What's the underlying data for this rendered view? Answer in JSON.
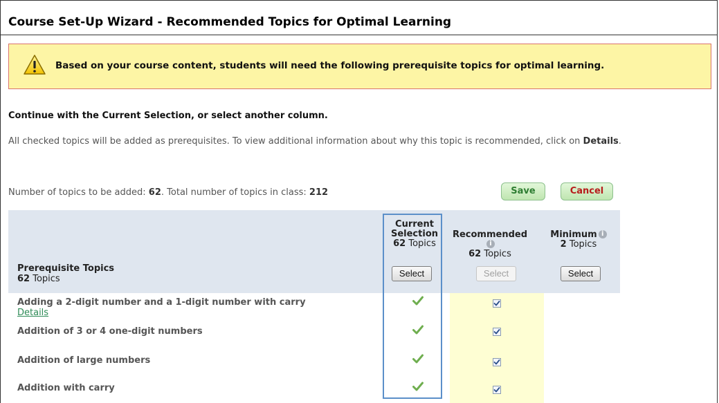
{
  "header": {
    "title": "Course Set-Up Wizard - Recommended Topics for Optimal Learning"
  },
  "banner": {
    "icon": "warning-icon",
    "text": "Based on your course content, students will need the following prerequisite topics for optimal learning."
  },
  "instructions": {
    "main": "Continue with the Current Selection, or select another column.",
    "desc_prefix": "All checked topics will be added as prerequisites. To view additional information about why this topic is recommended, click on ",
    "desc_bold": "Details",
    "desc_suffix": "."
  },
  "summary": {
    "added_label": "Number of topics to be added: ",
    "added_value": "62",
    "total_label": ".  Total number of topics in class: ",
    "total_value": "212"
  },
  "actions": {
    "save_label": "Save",
    "cancel_label": "Cancel"
  },
  "table": {
    "name_header": "Prerequisite Topics",
    "name_count": "62",
    "name_count_suffix": " Topics",
    "columns": [
      {
        "label_line1": "Current",
        "label_line2": "Selection",
        "count": "62",
        "count_suffix": " Topics",
        "button": "Select",
        "button_enabled": true
      },
      {
        "label": "Recommended",
        "count": "62",
        "count_suffix": " Topics",
        "button": "Select",
        "button_enabled": false
      },
      {
        "label": "Minimum",
        "count": "2",
        "count_suffix": " Topics",
        "button": "Select",
        "button_enabled": true
      }
    ],
    "rows": [
      {
        "name": "Adding a 2-digit number and a 1-digit number with carry",
        "details": "Details",
        "current": true,
        "recommended": true,
        "minimum": false
      },
      {
        "name": "Addition of 3 or 4 one-digit numbers",
        "current": true,
        "recommended": true,
        "minimum": false
      },
      {
        "name": "Addition of large numbers",
        "current": true,
        "recommended": true,
        "minimum": false
      },
      {
        "name": "Addition with carry",
        "current": true,
        "recommended": true,
        "minimum": false
      }
    ]
  },
  "colors": {
    "banner_bg": "#fdf5a5",
    "banner_border": "#d9736b",
    "header_bg": "#dfe6ef",
    "recommended_bg": "#fefed3",
    "check_green": "#6fae4f",
    "highlight_blue": "#5b8fc9",
    "details_link": "#2e8b57"
  }
}
